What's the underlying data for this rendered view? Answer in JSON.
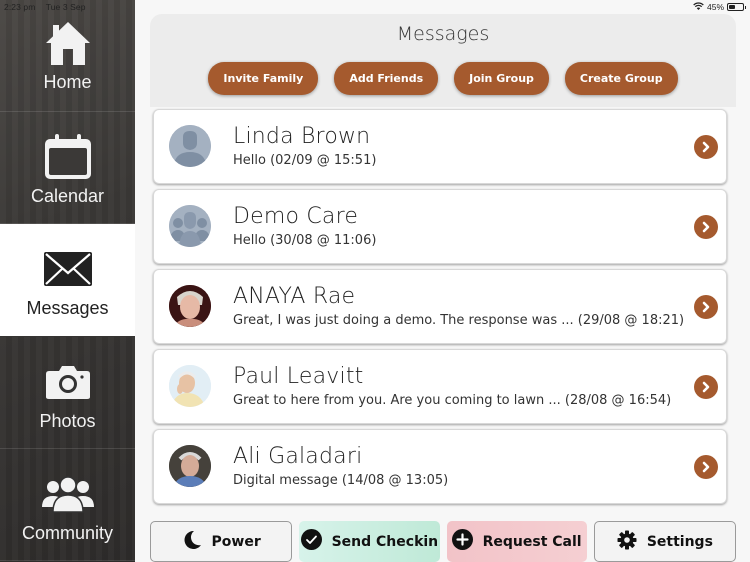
{
  "status_bar": {
    "time": "2:23 pm",
    "date": "Tue 3 Sep",
    "battery_percent": "45%",
    "battery_level": 0.45,
    "wifi_icon": "wifi-icon"
  },
  "sidebar": {
    "items": [
      {
        "label": "Home",
        "icon": "home-icon",
        "active": false
      },
      {
        "label": "Calendar",
        "icon": "calendar-icon",
        "active": false
      },
      {
        "label": "Messages",
        "icon": "envelope-icon",
        "active": true
      },
      {
        "label": "Photos",
        "icon": "camera-icon",
        "active": false
      },
      {
        "label": "Community",
        "icon": "people-icon",
        "active": false
      }
    ]
  },
  "header": {
    "title": "Messages",
    "actions": [
      {
        "label": "Invite Family"
      },
      {
        "label": "Add Friends"
      },
      {
        "label": "Join Group"
      },
      {
        "label": "Create Group"
      }
    ]
  },
  "conversations": [
    {
      "name": "Linda Brown",
      "preview": "Hello (02/09 @ 15:51)",
      "avatar": "person-placeholder-icon"
    },
    {
      "name": "Demo Care",
      "preview": "Hello (30/08 @ 11:06)",
      "avatar": "group-placeholder-icon"
    },
    {
      "name": "ANAYA Rae",
      "preview": "Great, I was just doing a demo. The response was ... (29/08 @ 18:21)",
      "avatar": "photo"
    },
    {
      "name": "Paul Leavitt",
      "preview": "Great to here from you. Are you coming to lawn ... (28/08 @ 16:54)",
      "avatar": "photo"
    },
    {
      "name": "Ali Galadari",
      "preview": "Digital message (14/08 @ 13:05)",
      "avatar": "photo"
    }
  ],
  "bottom_bar": {
    "power": "Power",
    "send_checkin": "Send Checkin",
    "request_call": "Request Call",
    "settings": "Settings"
  },
  "colors": {
    "accent": "#a55a2e",
    "checkin_bg": "#c9eee0",
    "call_bg": "#f3c7cb"
  }
}
